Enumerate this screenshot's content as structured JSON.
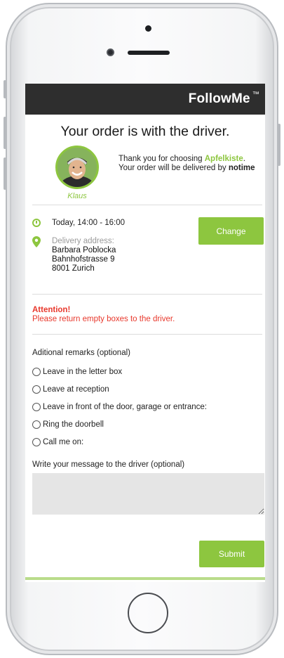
{
  "app": {
    "brand": "FollowMe",
    "trademark": "™"
  },
  "order": {
    "heading": "Your order is with the driver.",
    "thanks_prefix": "Thank you for choosing ",
    "shop_name": "Apfelkiste",
    "thanks_suffix": ".",
    "delivered_by_prefix": "Your order will be delivered by ",
    "courier": "notime",
    "driver_name": "Klaus"
  },
  "delivery": {
    "time": "Today, 14:00 - 16:00",
    "address_label": "Delivery address:",
    "address_lines": [
      "Barbara Poblocka",
      "Bahnhofstrasse 9",
      "8001 Zurich"
    ],
    "change_label": "Change"
  },
  "attention": {
    "title": "Attention!",
    "message": "Please return empty boxes to the driver."
  },
  "remarks": {
    "title": "Aditional remarks (optional)",
    "options": [
      "Leave in the letter box",
      "Leave at reception",
      "Leave in front of the door, garage or entrance:",
      "Ring the doorbell",
      "Call me on:"
    ],
    "message_label": "Write your message to the driver (optional)",
    "message_value": ""
  },
  "submit_label": "Submit",
  "colors": {
    "accent": "#8dc63f",
    "warning": "#e8382c",
    "topbar": "#2e2e2e"
  }
}
